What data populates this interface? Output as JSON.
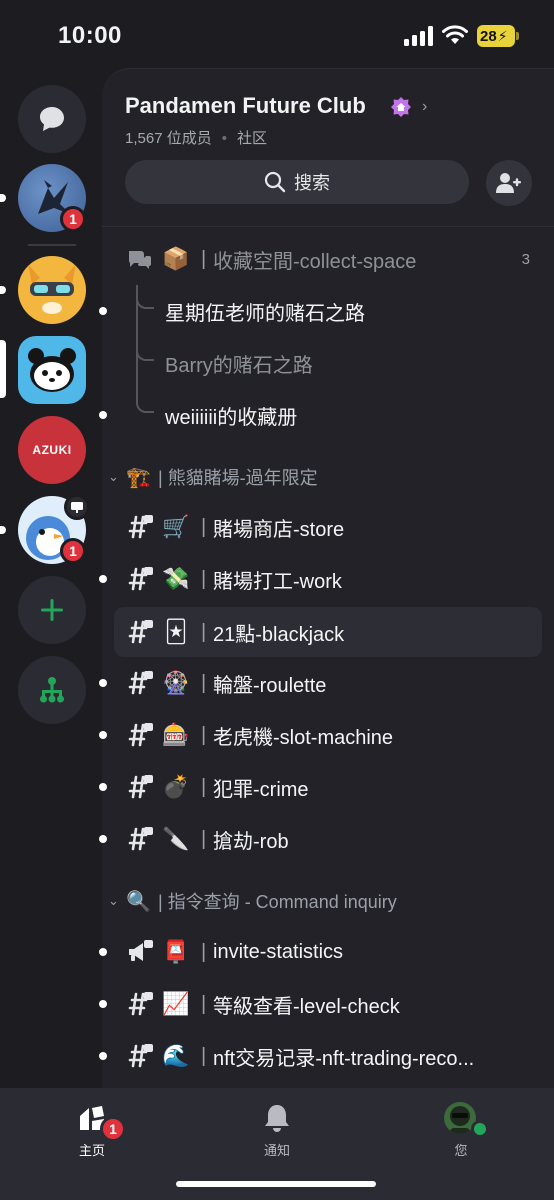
{
  "status_bar": {
    "time": "10:00",
    "battery": "28"
  },
  "rail": {
    "servers": [
      {
        "name": "direct-messages"
      },
      {
        "name": "server-bird",
        "badge": "1"
      },
      {
        "name": "server-cat"
      },
      {
        "name": "server-panda"
      },
      {
        "name": "server-azuki",
        "label": "AZUKI"
      },
      {
        "name": "server-penguin",
        "badge": "1"
      },
      {
        "name": "add-server"
      },
      {
        "name": "discover"
      }
    ]
  },
  "guild": {
    "name": "Pandamen Future Club",
    "members": "1,567 位成员",
    "type": "社区",
    "search_label": "搜索"
  },
  "forum": {
    "emoji": "📦",
    "name": "收藏空間-collect-space",
    "count": "3",
    "threads": [
      "星期伍老师的赌石之路",
      "Barry的赌石之路",
      "weiiiiii的收藏册"
    ]
  },
  "categories": [
    {
      "emoji": "🏗️",
      "name": "熊貓賭場-過年限定"
    },
    {
      "emoji": "🔍",
      "name": "指令查询 - Command inquiry"
    }
  ],
  "channels_casino": [
    {
      "emoji": "🛒",
      "name": "賭場商店-store"
    },
    {
      "emoji": "💸",
      "name": "賭場打工-work"
    },
    {
      "emoji": "🃏",
      "name": "21點-blackjack"
    },
    {
      "emoji": "🎡",
      "name": "輪盤-roulette"
    },
    {
      "emoji": "🎰",
      "name": "老虎機-slot-machine"
    },
    {
      "emoji": "💣",
      "name": "犯罪-crime"
    },
    {
      "emoji": "🔪",
      "name": "搶劫-rob"
    }
  ],
  "channels_command": [
    {
      "emoji": "📮",
      "name": "invite-statistics"
    },
    {
      "emoji": "📈",
      "name": "等級查看-level-check"
    },
    {
      "emoji": "🌊",
      "name": "nft交易记录-nft-trading-reco..."
    }
  ],
  "tabs": [
    {
      "label": "主页",
      "badge": "1"
    },
    {
      "label": "通知"
    },
    {
      "label": "您"
    }
  ],
  "colors": {
    "accent_green": "#23a55a",
    "badge_red": "#e0323c",
    "azuki_red": "#c8323a",
    "boost_purple": "#c274e8"
  }
}
